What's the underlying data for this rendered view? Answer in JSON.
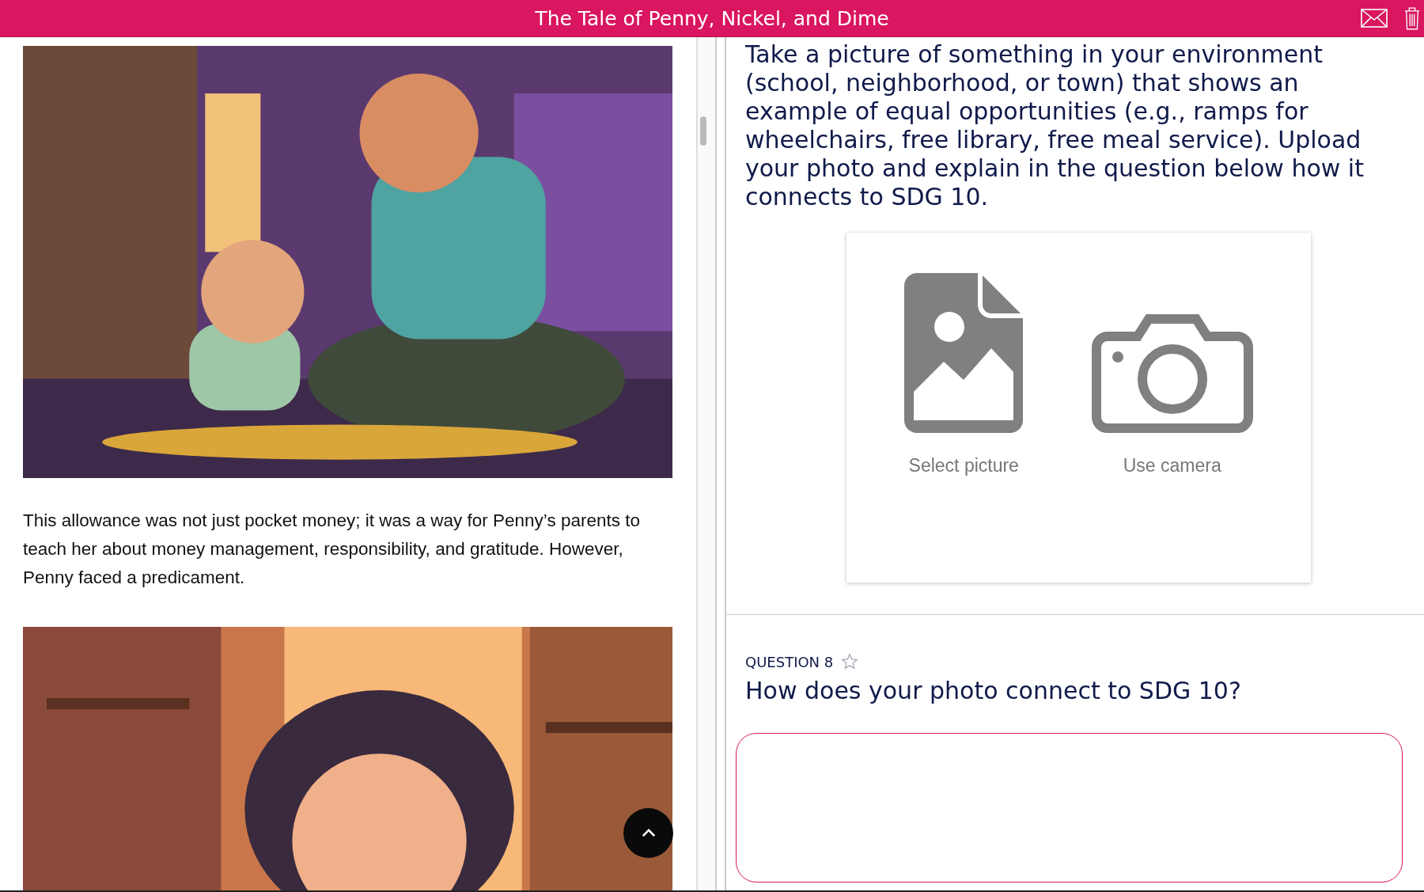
{
  "header": {
    "title": "The Tale of Penny, Nickel, and Dime"
  },
  "story": {
    "blocks": [
      {
        "kind": "picture"
      },
      {
        "kind": "paragraph",
        "text": "This allowance was not just pocket money; it was a way for Penny’s parents to teach her about money management, responsibility, and gratitude. However, Penny faced a predicament."
      },
      {
        "kind": "picture"
      }
    ]
  },
  "task": {
    "prompt": "Take a picture of something in your environment (school, neighborhood, or town) that shows an example of equal opportunities (e.g., ramps for wheelchairs, free library, free meal service). Upload your photo and explain in the question below how it connects to SDG 10.",
    "upload_options": [
      {
        "kind": "gallery",
        "label": "Select picture"
      },
      {
        "kind": "camera",
        "label": "Use camera"
      }
    ]
  },
  "question": {
    "label": "QUESTION 8",
    "starred": false,
    "text": "How does your photo connect to SDG 10?"
  }
}
